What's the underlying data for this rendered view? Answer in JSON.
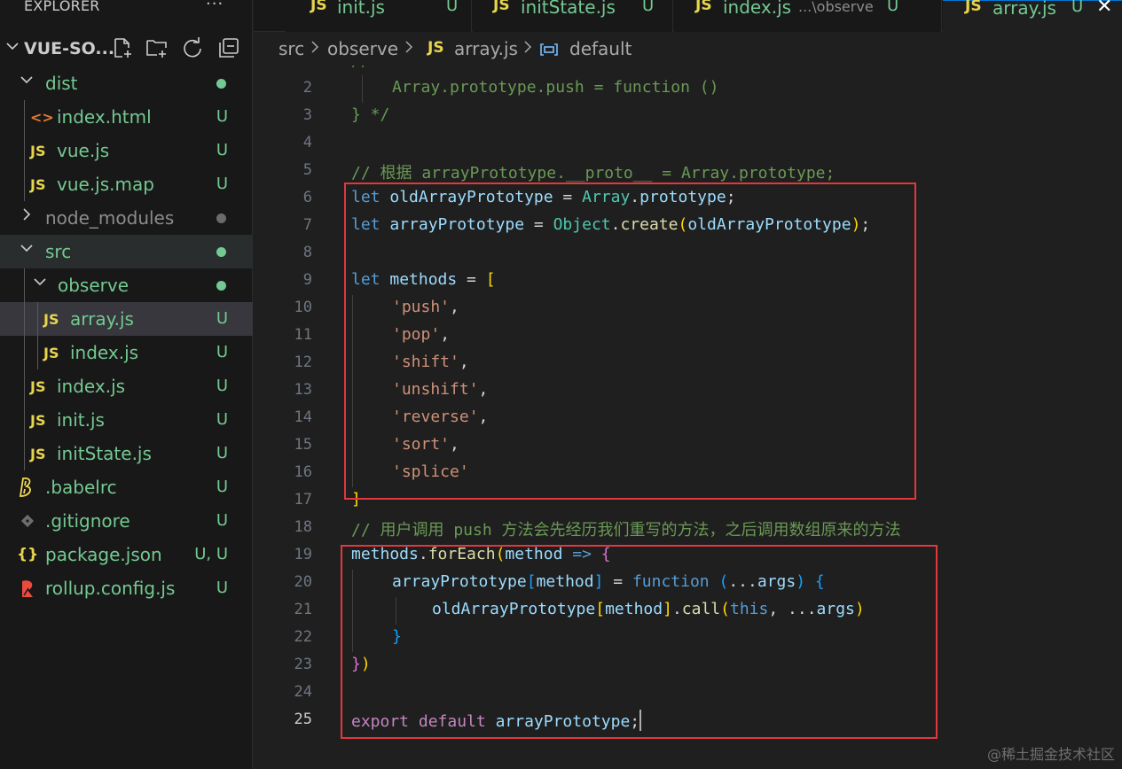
{
  "explorer": {
    "title": "EXPLORER",
    "more": "···",
    "root_label": "VUE-SO...",
    "tools": [
      "new-file-icon",
      "new-folder-icon",
      "refresh-icon",
      "collapse-all-icon"
    ],
    "items": [
      {
        "label": "dist",
        "status": "",
        "kind": "folder-open"
      },
      {
        "label": "index.html",
        "status": "U",
        "kind": "html"
      },
      {
        "label": "vue.js",
        "status": "U",
        "kind": "js"
      },
      {
        "label": "vue.js.map",
        "status": "U",
        "kind": "js"
      },
      {
        "label": "node_modules",
        "status": "",
        "kind": "folder-closed"
      },
      {
        "label": "src",
        "status": "",
        "kind": "folder-open"
      },
      {
        "label": "observe",
        "status": "",
        "kind": "folder-open"
      },
      {
        "label": "array.js",
        "status": "U",
        "kind": "js"
      },
      {
        "label": "index.js",
        "status": "U",
        "kind": "js"
      },
      {
        "label": "index.js",
        "status": "U",
        "kind": "js"
      },
      {
        "label": "init.js",
        "status": "U",
        "kind": "js"
      },
      {
        "label": "initState.js",
        "status": "U",
        "kind": "js"
      },
      {
        "label": ".babelrc",
        "status": "U",
        "kind": "babel"
      },
      {
        "label": ".gitignore",
        "status": "U",
        "kind": "git"
      },
      {
        "label": "package.json",
        "status": "U, U",
        "kind": "json"
      },
      {
        "label": "rollup.config.js",
        "status": "U",
        "kind": "rollup"
      }
    ],
    "icon_text": {
      "js": "JS",
      "json": "{}",
      "html": "<>"
    }
  },
  "tabs": [
    {
      "icon": "JS",
      "label": "init.js",
      "desc": "",
      "status": "U"
    },
    {
      "icon": "JS",
      "label": "initState.js",
      "desc": "",
      "status": "U"
    },
    {
      "icon": "JS",
      "label": "index.js",
      "desc": "...\\observe",
      "status": "U"
    },
    {
      "icon": "JS",
      "label": "array.js",
      "desc": "",
      "status": "U",
      "close": "✕"
    }
  ],
  "breadcrumb": {
    "parts": [
      "src",
      "observe",
      "array.js",
      "default"
    ],
    "file_icon": "JS"
  },
  "editor": {
    "line_numbers": [
      "1",
      "2",
      "3",
      "4",
      "5",
      "6",
      "7",
      "8",
      "9",
      "10",
      "11",
      "12",
      "13",
      "14",
      "15",
      "16",
      "17",
      "18",
      "19",
      "20",
      "21",
      "22",
      "23",
      "24",
      "25"
    ],
    "current_line": "25",
    "partial_line_1": "// ...",
    "line_2": "Array.prototype.push = function ()",
    "line_3": "} */",
    "comment_5": "// 根据 arrayPrototype.__proto__ = Array.prototype;",
    "comment_18": "// 用户调用 push 方法会先经历我们重写的方法，之后调用数组原来的方法",
    "methods": [
      "'push'",
      "'pop'",
      "'shift'",
      "'unshift'",
      "'reverse'",
      "'sort'",
      "'splice'"
    ],
    "tokens": {
      "let": "let",
      "oldArrayPrototype": "oldArrayPrototype",
      "arrayPrototype": "arrayPrototype",
      "Array": "Array",
      "prototype": "prototype",
      "Object": "Object",
      "create": "create",
      "methodsVar": "methods",
      "forEach": "forEach",
      "method": "method",
      "function": "function",
      "args": "args",
      "call": "call",
      "this": "this",
      "export": "export",
      "default": "default"
    }
  },
  "watermark": "@稀土掘金技术社区",
  "colors": {
    "accent_box": "#e0383c",
    "untracked": "#73c991",
    "js_icon": "#e8d44d"
  }
}
